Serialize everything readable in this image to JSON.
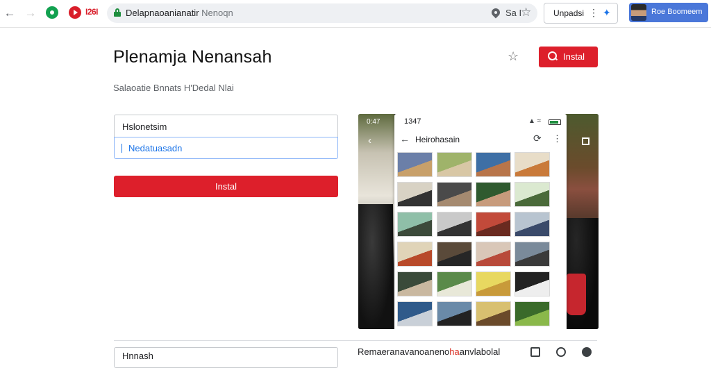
{
  "browser": {
    "back_icon": "arrow-left-icon",
    "forward_icon": "arrow-right-icon",
    "extension_label": "I26I",
    "url": {
      "host": "Delapnaoanianatir",
      "path": " Nenoqn",
      "right_text": "Sa I"
    },
    "updates_button": "Unpadsi",
    "profile_name": "Roe Boomeem"
  },
  "page": {
    "app_title": "Plenamja Nenansah",
    "subtitle": "Salaoatie Bnnats H'Dedal Nlai",
    "install_top_label": "Instal",
    "form": {
      "label": "Hslonetsim",
      "input_value": "Nedatuasadn"
    },
    "install_main_label": "Instal",
    "bottom_field_label": "Hnnash",
    "bottom_text_before": "Remaeranavanoaneno",
    "bottom_text_highlight": "ha",
    "bottom_text_after": "anvlabolal"
  },
  "preview": {
    "bg_time": "0:47",
    "phone_time": "1347",
    "phone_title": "Heirohasain"
  },
  "colors": {
    "accent_red": "#dd1f2b",
    "link_blue": "#1a73e8",
    "profile_blue": "#4a77d9"
  }
}
